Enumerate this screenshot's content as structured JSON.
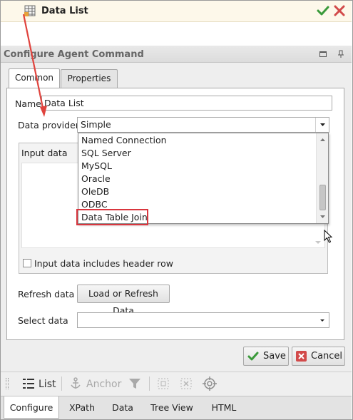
{
  "top": {
    "title": "Data List"
  },
  "panel": {
    "title": "Configure Agent Command"
  },
  "tabs": {
    "common": "Common",
    "properties": "Properties"
  },
  "form": {
    "name_label": "Name",
    "name_value": "Data List",
    "provider_label": "Data provider",
    "provider_value": "Simple",
    "input_data_label": "Input data",
    "header_row_label": "Input data includes header row",
    "refresh_label": "Refresh data",
    "refresh_button": "Load or Refresh Data",
    "select_label": "Select data",
    "select_value": ""
  },
  "dropdown": {
    "options": [
      "Named Connection",
      "SQL Server",
      "MySQL",
      "Oracle",
      "OleDB",
      "ODBC",
      "Data Table Join"
    ],
    "highlighted": "Data Table Join"
  },
  "actions": {
    "save": "Save",
    "cancel": "Cancel"
  },
  "toolbar": {
    "list": "List",
    "anchor": "Anchor"
  },
  "bottom_tabs": [
    "Configure",
    "XPath",
    "Data",
    "Tree View",
    "HTML"
  ],
  "colors": {
    "highlight_border": "#d9363e",
    "annotation_arrow": "#e0433d",
    "accept": "#3a9a3a",
    "reject": "#d24a4a"
  }
}
